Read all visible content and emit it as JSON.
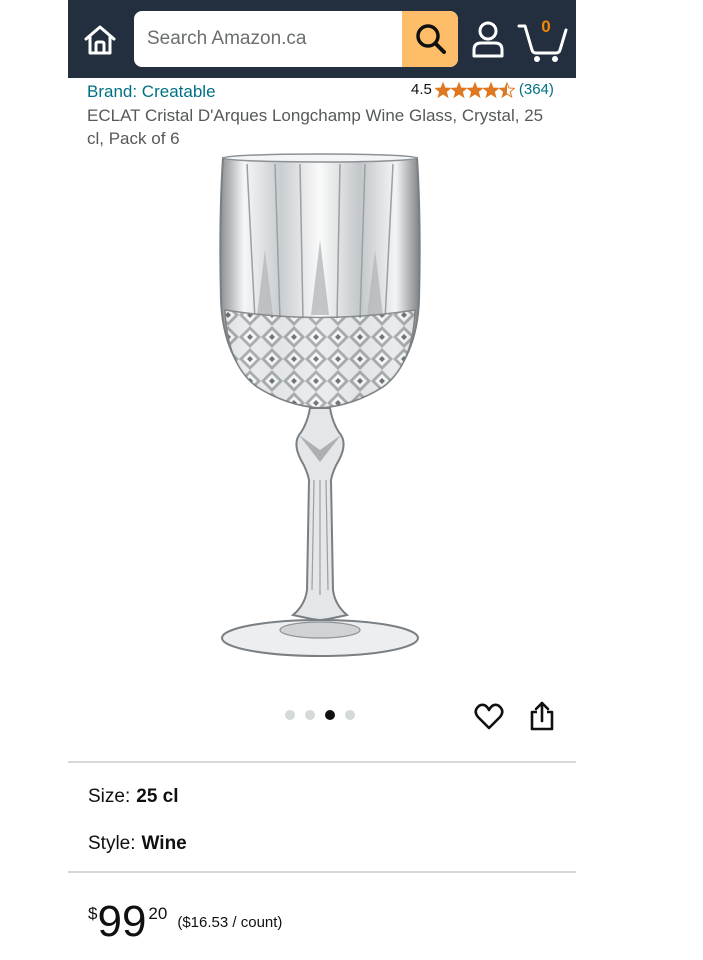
{
  "header": {
    "search_placeholder": "Search Amazon.ca",
    "cart_count": "0"
  },
  "product": {
    "brand": "Brand: Creatable",
    "rating": "4.5",
    "rating_stars": 4.5,
    "review_count": "(364)",
    "title": "ECLAT Cristal D'Arques Longchamp Wine Glass, Crystal, 25 cl, Pack of 6",
    "image_count": 4,
    "active_image_index": 2
  },
  "variations": {
    "size_label": "Size:",
    "size_value": "25 cl",
    "style_label": "Style:",
    "style_value": "Wine"
  },
  "price": {
    "symbol": "$",
    "whole": "99",
    "fraction": "20",
    "per_unit": "($16.53 / count)"
  },
  "colors": {
    "header_bg": "#232f3e",
    "search_button": "#febd69",
    "link": "#007185",
    "star": "#de7921",
    "cart_count": "#f08804"
  },
  "icons": [
    "home-icon",
    "search-icon",
    "account-icon",
    "cart-icon",
    "star-icon",
    "heart-icon",
    "share-icon"
  ]
}
